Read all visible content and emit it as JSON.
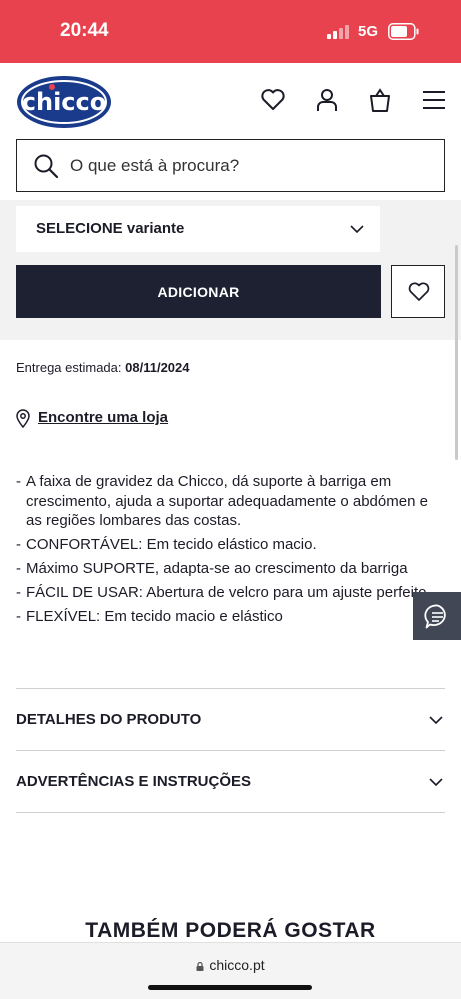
{
  "status_bar": {
    "time": "20:44",
    "network": "5G"
  },
  "header": {
    "logo_text": "chicco",
    "icons": [
      "heart-icon",
      "user-icon",
      "bag-icon",
      "menu-icon"
    ]
  },
  "search": {
    "placeholder": "O que está à procura?"
  },
  "product": {
    "variant_label": "SELECIONE variante",
    "add_button": "ADICIONAR",
    "delivery_label": "Entrega estimada:",
    "delivery_date": "08/11/2024",
    "store_link": "Encontre uma loja"
  },
  "description": {
    "items": [
      "A faixa de gravidez da Chicco, dá suporte à barriga em crescimento, ajuda a suportar adequadamente o abdómen e as regiões lombares das costas.",
      "CONFORTÁVEL: Em tecido elástico macio.",
      "Máximo SUPORTE, adapta-se ao crescimento da barriga",
      "FÁCIL DE USAR: Abertura de velcro para um ajuste perfeito.",
      "FLEXÍVEL: Em tecido macio e elástico"
    ]
  },
  "accordions": [
    {
      "title": "DETALHES DO PRODUTO"
    },
    {
      "title": "ADVERTÊNCIAS E INSTRUÇÕES"
    }
  ],
  "also_like": "TAMBÉM PODERÁ GOSTAR",
  "browser": {
    "url": "chicco.pt"
  },
  "colors": {
    "status_bar": "#e8424f",
    "brand_blue": "#1a3a8c",
    "button_dark": "#1e2131"
  }
}
